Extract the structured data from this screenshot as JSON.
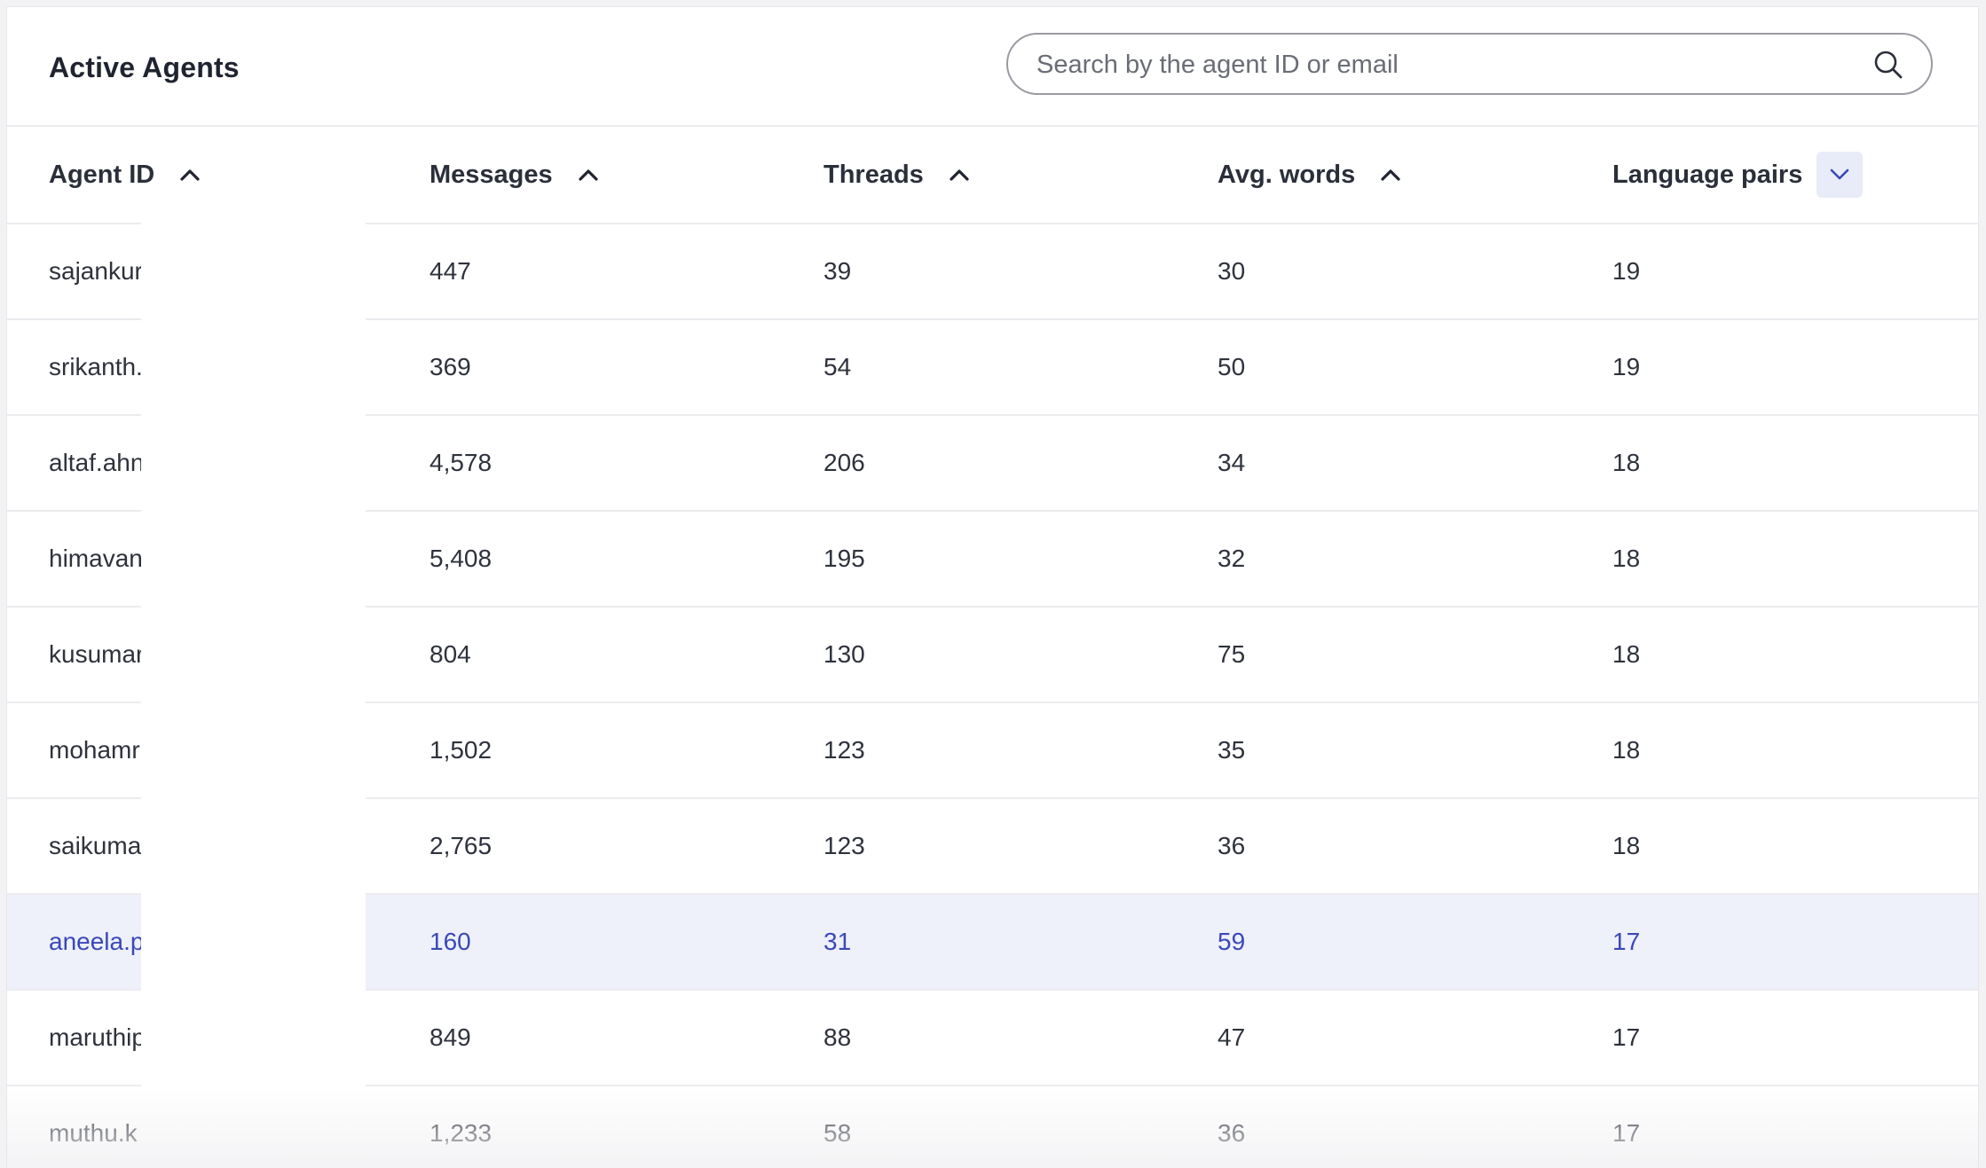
{
  "header": {
    "title": "Active Agents",
    "search_placeholder": "Search by the agent ID or email"
  },
  "columns": [
    {
      "label": "Agent ID",
      "sort": "chevron-up-icon"
    },
    {
      "label": "Messages",
      "sort": "chevron-up-icon"
    },
    {
      "label": "Threads",
      "sort": "chevron-up-icon"
    },
    {
      "label": "Avg. words",
      "sort": "chevron-up-icon"
    },
    {
      "label": "Language pairs",
      "sort": "chevron-down-icon"
    }
  ],
  "rows": [
    {
      "agent": "sajankur",
      "messages": "447",
      "threads": "39",
      "avg_words": "30",
      "language_pairs": "19"
    },
    {
      "agent": "srikanth.",
      "messages": "369",
      "threads": "54",
      "avg_words": "50",
      "language_pairs": "19"
    },
    {
      "agent": "altaf.ahn",
      "messages": "4,578",
      "threads": "206",
      "avg_words": "34",
      "language_pairs": "18"
    },
    {
      "agent": "himavan",
      "messages": "5,408",
      "threads": "195",
      "avg_words": "32",
      "language_pairs": "18"
    },
    {
      "agent": "kusumar",
      "messages": "804",
      "threads": "130",
      "avg_words": "75",
      "language_pairs": "18"
    },
    {
      "agent": "mohamr",
      "messages": "1,502",
      "threads": "123",
      "avg_words": "35",
      "language_pairs": "18"
    },
    {
      "agent": "saikuma",
      "messages": "2,765",
      "threads": "123",
      "avg_words": "36",
      "language_pairs": "18"
    },
    {
      "agent": "aneela.p",
      "messages": "160",
      "threads": "31",
      "avg_words": "59",
      "language_pairs": "17"
    },
    {
      "agent": "maruthip",
      "messages": "849",
      "threads": "88",
      "avg_words": "47",
      "language_pairs": "17"
    },
    {
      "agent": "muthu.k",
      "messages": "1,233",
      "threads": "58",
      "avg_words": "36",
      "language_pairs": "17"
    }
  ],
  "colors": {
    "highlight_row_bg": "#eef0fa",
    "highlight_text": "#3a48b8",
    "dropdown_bg": "#e8ebf8"
  }
}
